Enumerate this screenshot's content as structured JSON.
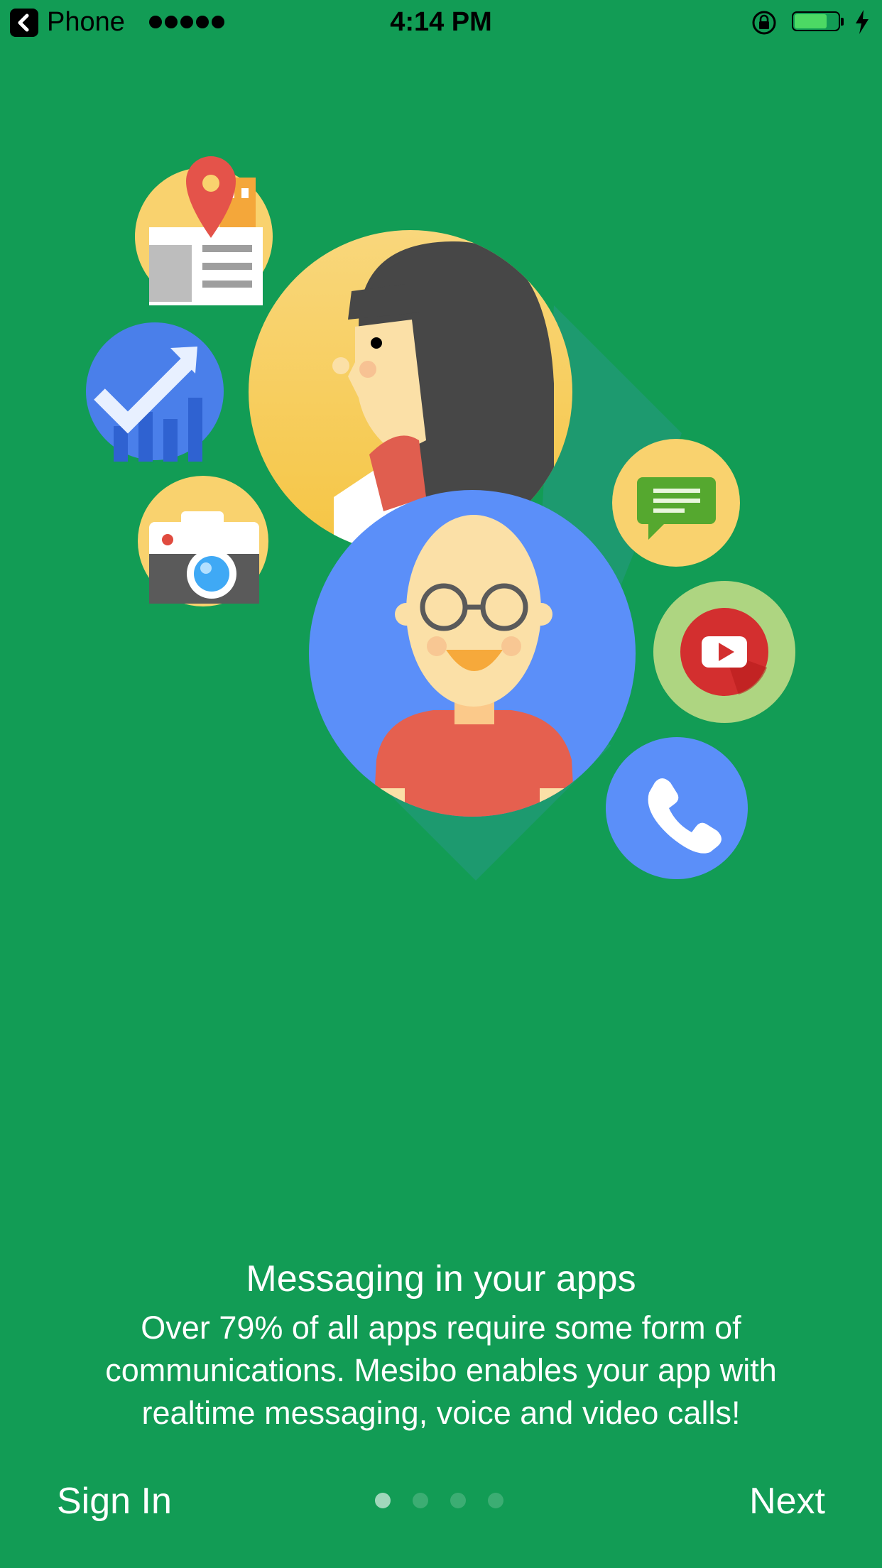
{
  "status_bar": {
    "back_label": "Phone",
    "signal_dots": 5,
    "time": "4:14 PM",
    "battery_level": 0.75,
    "battery_color": "#4CD964"
  },
  "illustration": {
    "icons": [
      "map-pin-icon",
      "trending-up-icon",
      "camera-icon",
      "chat-bubble-icon",
      "video-play-icon",
      "phone-icon"
    ],
    "avatars": [
      "woman-avatar",
      "bald-man-avatar"
    ]
  },
  "onboarding": {
    "title": "Messaging in your apps",
    "description_lines": [
      "Over 79% of all apps require some form of",
      "communications. Mesibo enables your app with",
      "realtime messaging, voice and video calls!"
    ],
    "sign_in_label": "Sign In",
    "next_label": "Next",
    "page_count": 4,
    "current_page": 1
  },
  "colors": {
    "background": "#129C55",
    "avatar_blue": "#5B8FF9",
    "avatar_yellow": "#F9D26E",
    "text": "#FFFFFF"
  }
}
